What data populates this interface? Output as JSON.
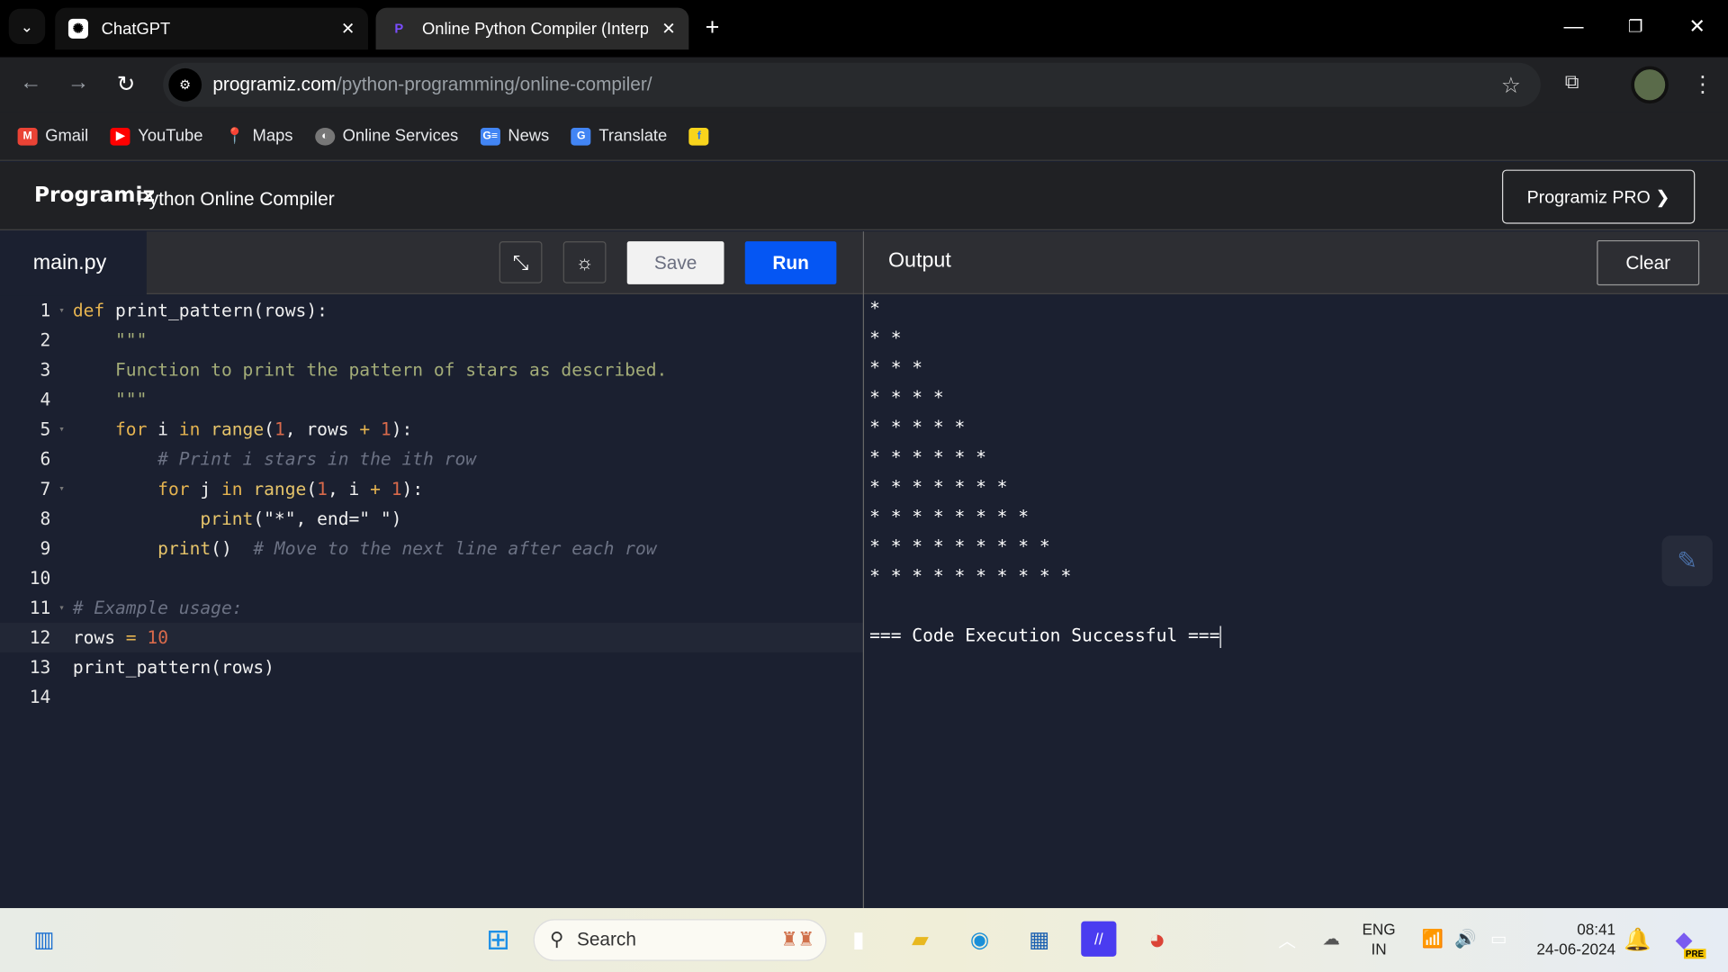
{
  "browser": {
    "tabs": [
      {
        "title": "ChatGPT",
        "icon": "chatgpt-icon",
        "active": false
      },
      {
        "title": "Online Python Compiler (Interpr",
        "icon": "programiz-icon",
        "active": true
      }
    ],
    "new_tab": "+",
    "url_domain": "programiz.com",
    "url_path": "/python-programming/online-compiler/",
    "bookmarks": [
      {
        "label": "Gmail",
        "icon": "gmail-icon",
        "color": "#ea4335"
      },
      {
        "label": "YouTube",
        "icon": "youtube-icon",
        "color": "#ff0000"
      },
      {
        "label": "Maps",
        "icon": "maps-icon",
        "color": "#34a853"
      },
      {
        "label": "Online Services",
        "icon": "globe-icon",
        "color": "#777777"
      },
      {
        "label": "News",
        "icon": "google-news-icon",
        "color": "#4285f4"
      },
      {
        "label": "Translate",
        "icon": "google-translate-icon",
        "color": "#4285f4"
      },
      {
        "label": "",
        "icon": "flipkart-icon",
        "color": "#f8d41c"
      }
    ]
  },
  "app": {
    "logo": "Programiz",
    "title": "Python Online Compiler",
    "pro_button": "Programiz PRO ❯",
    "file_tab": "main.py",
    "save": "Save",
    "run": "Run",
    "output_label": "Output",
    "clear": "Clear"
  },
  "editor": {
    "active_line": 12,
    "lines": [
      {
        "n": "1",
        "fold": true,
        "tokens": [
          [
            "kw",
            "def "
          ],
          [
            "fn",
            "print_pattern(rows):"
          ]
        ]
      },
      {
        "n": "2",
        "tokens": [
          [
            "str",
            "    \"\"\""
          ]
        ]
      },
      {
        "n": "3",
        "tokens": [
          [
            "str",
            "    Function to print the pattern of stars as described."
          ]
        ]
      },
      {
        "n": "4",
        "tokens": [
          [
            "str",
            "    \"\"\""
          ]
        ]
      },
      {
        "n": "5",
        "fold": true,
        "tokens": [
          [
            "kw",
            "    for "
          ],
          [
            "fn",
            "i "
          ],
          [
            "kw",
            "in "
          ],
          [
            "bi",
            "range"
          ],
          [
            "fn",
            "("
          ],
          [
            "num",
            "1"
          ],
          [
            "fn",
            ", rows "
          ],
          [
            "op",
            "+ "
          ],
          [
            "num",
            "1"
          ],
          [
            "fn",
            "):"
          ]
        ]
      },
      {
        "n": "6",
        "tokens": [
          [
            "cm",
            "        # Print i stars in the ith row"
          ]
        ]
      },
      {
        "n": "7",
        "fold": true,
        "tokens": [
          [
            "kw",
            "        for "
          ],
          [
            "fn",
            "j "
          ],
          [
            "kw",
            "in "
          ],
          [
            "bi",
            "range"
          ],
          [
            "fn",
            "("
          ],
          [
            "num",
            "1"
          ],
          [
            "fn",
            ", i "
          ],
          [
            "op",
            "+ "
          ],
          [
            "num",
            "1"
          ],
          [
            "fn",
            "):"
          ]
        ]
      },
      {
        "n": "8",
        "tokens": [
          [
            "bi",
            "            print"
          ],
          [
            "fn",
            "(\"*\", end=\" \")"
          ]
        ]
      },
      {
        "n": "9",
        "tokens": [
          [
            "bi",
            "        print"
          ],
          [
            "fn",
            "()  "
          ],
          [
            "cm",
            "# Move to the next line after each row"
          ]
        ]
      },
      {
        "n": "10",
        "tokens": []
      },
      {
        "n": "11",
        "fold": true,
        "tokens": [
          [
            "cm",
            "# Example usage:"
          ]
        ]
      },
      {
        "n": "12",
        "tokens": [
          [
            "fn",
            "rows "
          ],
          [
            "op",
            "= "
          ],
          [
            "num",
            "10"
          ]
        ]
      },
      {
        "n": "13",
        "tokens": [
          [
            "fn",
            "print_pattern(rows)"
          ]
        ]
      },
      {
        "n": "14",
        "tokens": []
      }
    ]
  },
  "output": {
    "lines": [
      "*",
      "* *",
      "* * *",
      "* * * *",
      "* * * * *",
      "* * * * * *",
      "* * * * * * *",
      "* * * * * * * *",
      "* * * * * * * * *",
      "* * * * * * * * * *",
      "",
      "=== Code Execution Successful ==="
    ]
  },
  "taskbar": {
    "search_placeholder": "Search",
    "apps": [
      "widgets-icon",
      "windows-start-icon",
      "task-view-icon",
      "file-explorer-icon",
      "edge-icon",
      "microsoft-store-icon",
      "vscode-like-icon",
      "chrome-icon"
    ],
    "lang_top": "ENG",
    "lang_bottom": "IN",
    "time": "08:41",
    "date": "24-06-2024",
    "copilot_badge": "PRE"
  }
}
